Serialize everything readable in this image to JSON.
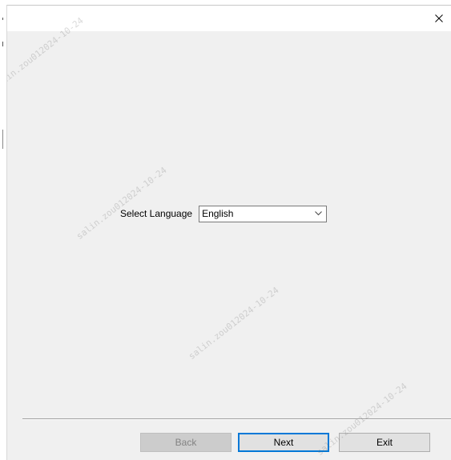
{
  "window": {
    "title": "",
    "close_glyph": "×"
  },
  "language": {
    "label": "Select Language",
    "selected": "English"
  },
  "buttons": {
    "back_label": "Back",
    "next_label": "Next",
    "exit_label": "Exit"
  },
  "watermark": {
    "text": "salin.zou012024-10-24"
  },
  "icons": {
    "close": "close-icon",
    "dropdown": "chevron-down-icon"
  },
  "colors": {
    "window_bg": "#f0f0f0",
    "titlebar_bg": "#ffffff",
    "default_button_border": "#0078d7",
    "disabled_text": "#838383"
  }
}
